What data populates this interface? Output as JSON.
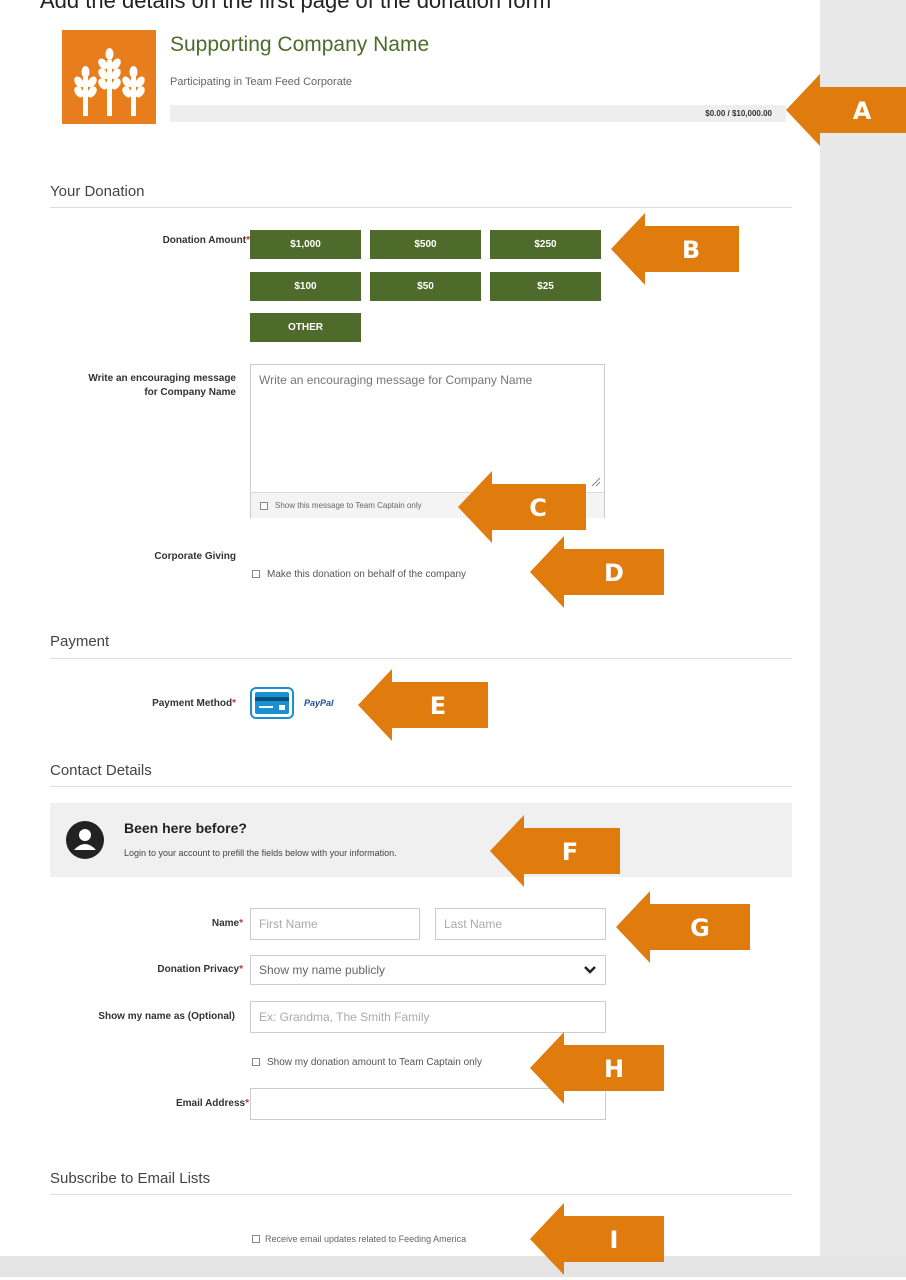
{
  "top_cut_text": "Add the details on the first page of the donation form",
  "campaign": {
    "company_name": "Supporting Company Name",
    "participating": "Participating in Team Feed Corporate",
    "progress_text": "$0.00 / $10,000.00",
    "progress_fraction": 0
  },
  "sections": {
    "donation": "Your Donation",
    "payment": "Payment",
    "contact": "Contact Details",
    "subscribe": "Subscribe to Email Lists"
  },
  "donation": {
    "amount_label": "Donation Amount",
    "amounts": [
      "$1,000",
      "$500",
      "$250",
      "$100",
      "$50",
      "$25"
    ],
    "other_label": "OTHER",
    "message_label_line1": "Write an encouraging message",
    "message_label_line2": "for Company Name",
    "message_placeholder": "Write an encouraging message for Company Name",
    "message_captain_only": "Show this message to Team Captain only",
    "corporate_label": "Corporate Giving",
    "corporate_checkbox": "Make this donation on behalf of the company"
  },
  "payment": {
    "method_label": "Payment Method",
    "paypal_label": "PayPal"
  },
  "contact": {
    "login_title": "Been here before?",
    "login_text": "Login to your account to prefill the fields below with your information.",
    "name_label": "Name",
    "first_name_placeholder": "First Name",
    "last_name_placeholder": "Last Name",
    "privacy_label": "Donation Privacy",
    "privacy_value": "Show my name publicly",
    "show_name_label": "Show my name as (Optional)",
    "show_name_placeholder": "Ex: Grandma, The Smith Family",
    "amount_captain_only": "Show my donation amount to Team Captain only",
    "email_label": "Email Address"
  },
  "subscribe": {
    "checkbox_label": "Receive email updates related to Feeding America"
  },
  "callouts": [
    "A",
    "B",
    "C",
    "D",
    "E",
    "F",
    "G",
    "H",
    "I"
  ],
  "colors": {
    "brand_green": "#4e6b2b",
    "logo_orange": "#e87d1e",
    "callout_orange": "#e07b0d",
    "required_red": "#c0392b"
  }
}
